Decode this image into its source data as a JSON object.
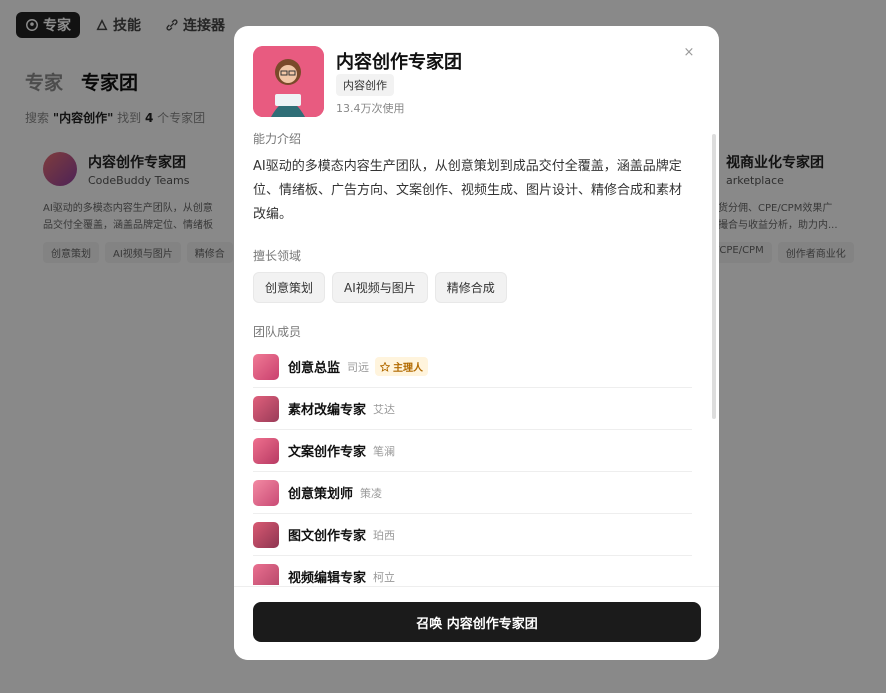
{
  "nav": {
    "experts": "专家",
    "skills": "技能",
    "connectors": "连接器"
  },
  "heading": {
    "experts": "专家",
    "teams": "专家团"
  },
  "search_result": {
    "prefix": "搜索 ",
    "query": "\"内容创作\"",
    "middle": " 找到 ",
    "count": "4",
    "suffix": " 个专家团"
  },
  "bg_cards": [
    {
      "name": "内容创作专家团",
      "sub": "CodeBuddy Teams",
      "desc": [
        "AI驱动的多模态内容生产团队，从创意",
        "品交付全覆盖，涵盖品牌定位、情绪板"
      ],
      "tags": [
        "创意策划",
        "AI视频与图片",
        "精修合"
      ]
    },
    {
      "name": "视商业化专家团",
      "sub": "arketplace",
      "desc": [
        "带货分佣、CPE/CPM效果广",
        "易撮合与收益分析，助力内..."
      ],
      "tags": [
        "/CPE/CPM",
        "创作者商业化"
      ]
    }
  ],
  "modal": {
    "title": "内容创作专家团",
    "category": "内容创作",
    "usage": "13.4万次使用",
    "intro_title": "能力介绍",
    "intro": "AI驱动的多模态内容生产团队，从创意策划到成品交付全覆盖，涵盖品牌定位、情绪板、广告方向、文案创作、视频生成、图片设计、精修合成和素材改编。",
    "areas_title": "擅长领域",
    "areas": [
      "创意策划",
      "AI视频与图片",
      "精修合成"
    ],
    "members_title": "团队成员",
    "members": [
      {
        "role": "创意总监",
        "alias": "司远",
        "lead": "主理人"
      },
      {
        "role": "素材改编专家",
        "alias": "艾达"
      },
      {
        "role": "文案创作专家",
        "alias": "笔澜"
      },
      {
        "role": "创意策划师",
        "alias": "策凌"
      },
      {
        "role": "图文创作专家",
        "alias": "珀西"
      },
      {
        "role": "视频编辑专家",
        "alias": "柯立"
      }
    ],
    "cta": "召唤 内容创作专家团",
    "close": "×"
  },
  "colors": {
    "accent": "#1b1b1b",
    "avatar_pink": "#e05a7e",
    "lead_bg": "#fff4dd"
  }
}
